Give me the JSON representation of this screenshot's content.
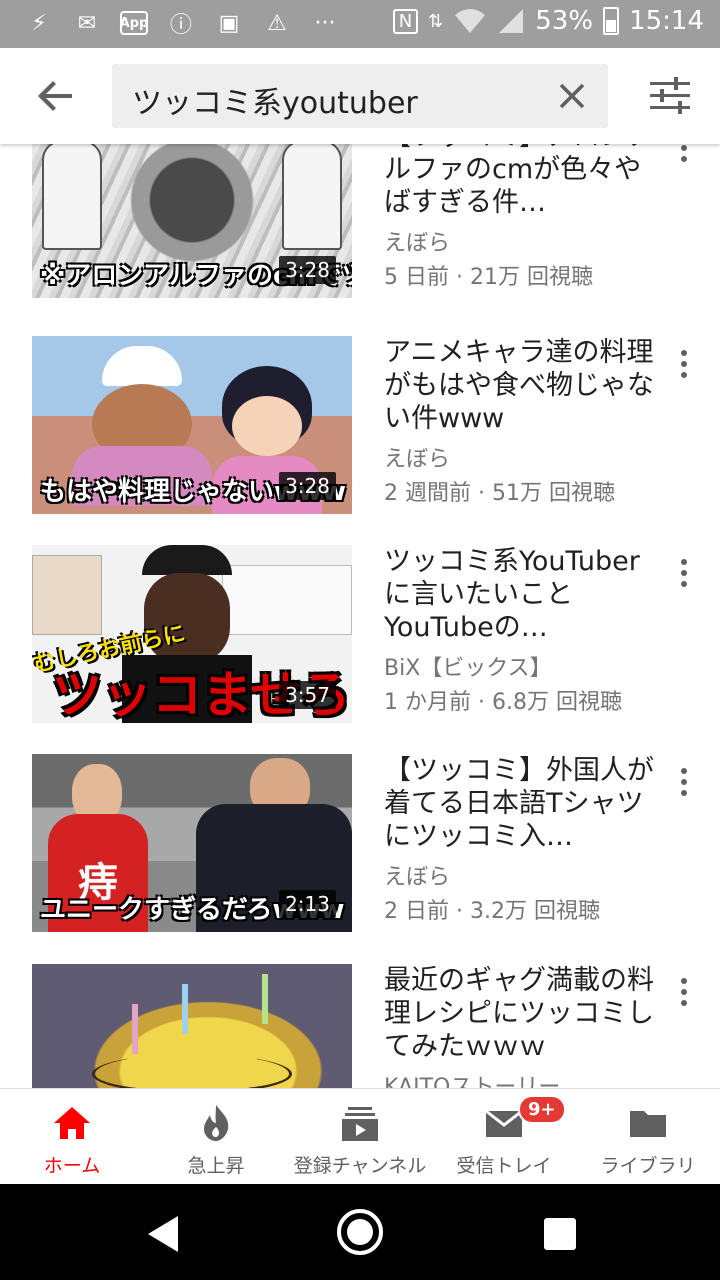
{
  "status_bar": {
    "battery": "53%",
    "time": "15:14",
    "app_badge": "App",
    "dots": "···",
    "nfc": "N"
  },
  "search": {
    "query": "ツッコミ系youtuber"
  },
  "results": [
    {
      "title": "【ツッコミ】アロンアルファのcmが色々やばすぎる件…",
      "channel": "えぼら",
      "meta": "5 日前 · 21万 回視聴",
      "duration": "3:28",
      "thumb_caption": "※アロンアルファのcmでツ"
    },
    {
      "title": "アニメキャラ達の料理がもはや食べ物じゃない件www",
      "channel": "えぼら",
      "meta": "2 週間前 · 51万 回視聴",
      "duration": "3:28",
      "thumb_caption": "もはや料理じゃないwww"
    },
    {
      "title": "ツッコミ系YouTuberに言いたいこと YouTubeの…",
      "channel": "BiX【ビックス】",
      "meta": "1 か月前 · 6.8万 回視聴",
      "duration": "3:57",
      "thumb_caption": "ツッコませろ"
    },
    {
      "title": "【ツッコミ】外国人が着てる日本語Tシャツにツッコミ入…",
      "channel": "えぼら",
      "meta": "2 日前 · 3.2万 回視聴",
      "duration": "2:13",
      "thumb_caption": "ユニークすぎるだろwww"
    },
    {
      "title": "最近のギャグ満載の料理レシピにツッコミしてみたｗｗｗ",
      "channel": "KAITOストーリー",
      "meta": "",
      "duration": "",
      "thumb_caption": ""
    }
  ],
  "bottom_nav": {
    "items": [
      {
        "label": "ホーム",
        "icon": "home-icon"
      },
      {
        "label": "急上昇",
        "icon": "flame-icon"
      },
      {
        "label": "登録チャンネル",
        "icon": "subscriptions-icon"
      },
      {
        "label": "受信トレイ",
        "icon": "inbox-icon"
      },
      {
        "label": "ライブラリ",
        "icon": "folder-icon"
      }
    ],
    "inbox_badge": "9+"
  },
  "colors": {
    "accent": "#ff0000",
    "status_bar": "#9e9e9e",
    "secondary_text": "#757575"
  }
}
